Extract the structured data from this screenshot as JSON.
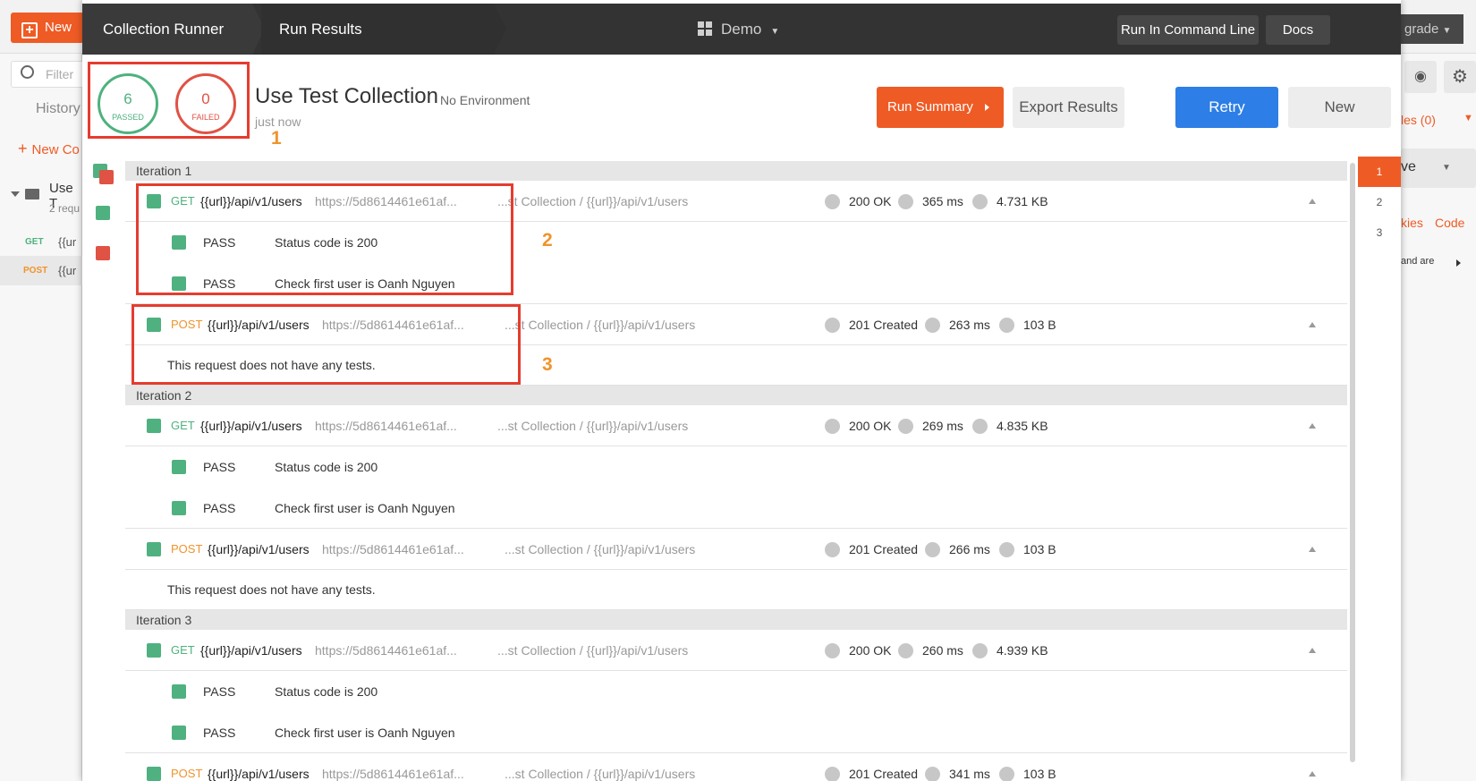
{
  "background_app": {
    "new_button": "New",
    "filter_placeholder": "Filter",
    "history_tab": "History",
    "new_collection": "New Co",
    "collection_name": "Use T",
    "collection_sub": "2 requ",
    "req1_method": "GET",
    "req1_url": "{{ur",
    "req2_method": "POST",
    "req2_url": "{{ur",
    "upgrade": "grade",
    "env_label": "les (0)",
    "save": "ve",
    "cookies": "kies",
    "code": "Code",
    "side_text": "and are"
  },
  "topbar": {
    "crumb1": "Collection Runner",
    "crumb2": "Run Results",
    "workspace": "Demo",
    "run_cli": "Run In Command Line",
    "docs": "Docs"
  },
  "summary": {
    "passed_count": "6",
    "passed_label": "PASSED",
    "failed_count": "0",
    "failed_label": "FAILED",
    "collection_title": "Use Test Collection",
    "environment": "No Environment",
    "time": "just now",
    "run_summary": "Run Summary",
    "export_results": "Export Results",
    "retry": "Retry",
    "new": "New"
  },
  "annotations": [
    "1",
    "2",
    "3"
  ],
  "iterations": [
    {
      "label": "Iteration 1",
      "get": {
        "method": "GET",
        "url": "{{url}}/api/v1/users",
        "full": "https://5d8614461e61af...",
        "path": "...st Collection / {{url}}/api/v1/users",
        "status": "200 OK",
        "time": "365 ms",
        "size": "4.731 KB"
      },
      "tests": [
        {
          "status": "PASS",
          "name": "Status code is 200"
        },
        {
          "status": "PASS",
          "name": "Check first user is Oanh Nguyen"
        }
      ],
      "post": {
        "method": "POST",
        "url": "{{url}}/api/v1/users",
        "full": "https://5d8614461e61af...",
        "path": "...st Collection / {{url}}/api/v1/users",
        "status": "201 Created",
        "time": "263 ms",
        "size": "103 B"
      },
      "no_tests": "This request does not have any tests."
    },
    {
      "label": "Iteration 2",
      "get": {
        "method": "GET",
        "url": "{{url}}/api/v1/users",
        "full": "https://5d8614461e61af...",
        "path": "...st Collection / {{url}}/api/v1/users",
        "status": "200 OK",
        "time": "269 ms",
        "size": "4.835 KB"
      },
      "tests": [
        {
          "status": "PASS",
          "name": "Status code is 200"
        },
        {
          "status": "PASS",
          "name": "Check first user is Oanh Nguyen"
        }
      ],
      "post": {
        "method": "POST",
        "url": "{{url}}/api/v1/users",
        "full": "https://5d8614461e61af...",
        "path": "...st Collection / {{url}}/api/v1/users",
        "status": "201 Created",
        "time": "266 ms",
        "size": "103 B"
      },
      "no_tests": "This request does not have any tests."
    },
    {
      "label": "Iteration 3",
      "get": {
        "method": "GET",
        "url": "{{url}}/api/v1/users",
        "full": "https://5d8614461e61af...",
        "path": "...st Collection / {{url}}/api/v1/users",
        "status": "200 OK",
        "time": "260 ms",
        "size": "4.939 KB"
      },
      "tests": [
        {
          "status": "PASS",
          "name": "Status code is 200"
        },
        {
          "status": "PASS",
          "name": "Check first user is Oanh Nguyen"
        }
      ],
      "post": {
        "method": "POST",
        "url": "{{url}}/api/v1/users",
        "full": "https://5d8614461e61af...",
        "path": "...st Collection / {{url}}/api/v1/users",
        "status": "201 Created",
        "time": "341 ms",
        "size": "103 B"
      }
    }
  ],
  "iteration_nav": [
    "1",
    "2",
    "3"
  ],
  "colors": {
    "accent": "#ef5b25",
    "pass_green": "#4fb17f",
    "fail_red": "#e05243",
    "retry_blue": "#2d7ee6",
    "annotation_red": "#e53c2f",
    "annotation_orange": "#f0932b"
  }
}
